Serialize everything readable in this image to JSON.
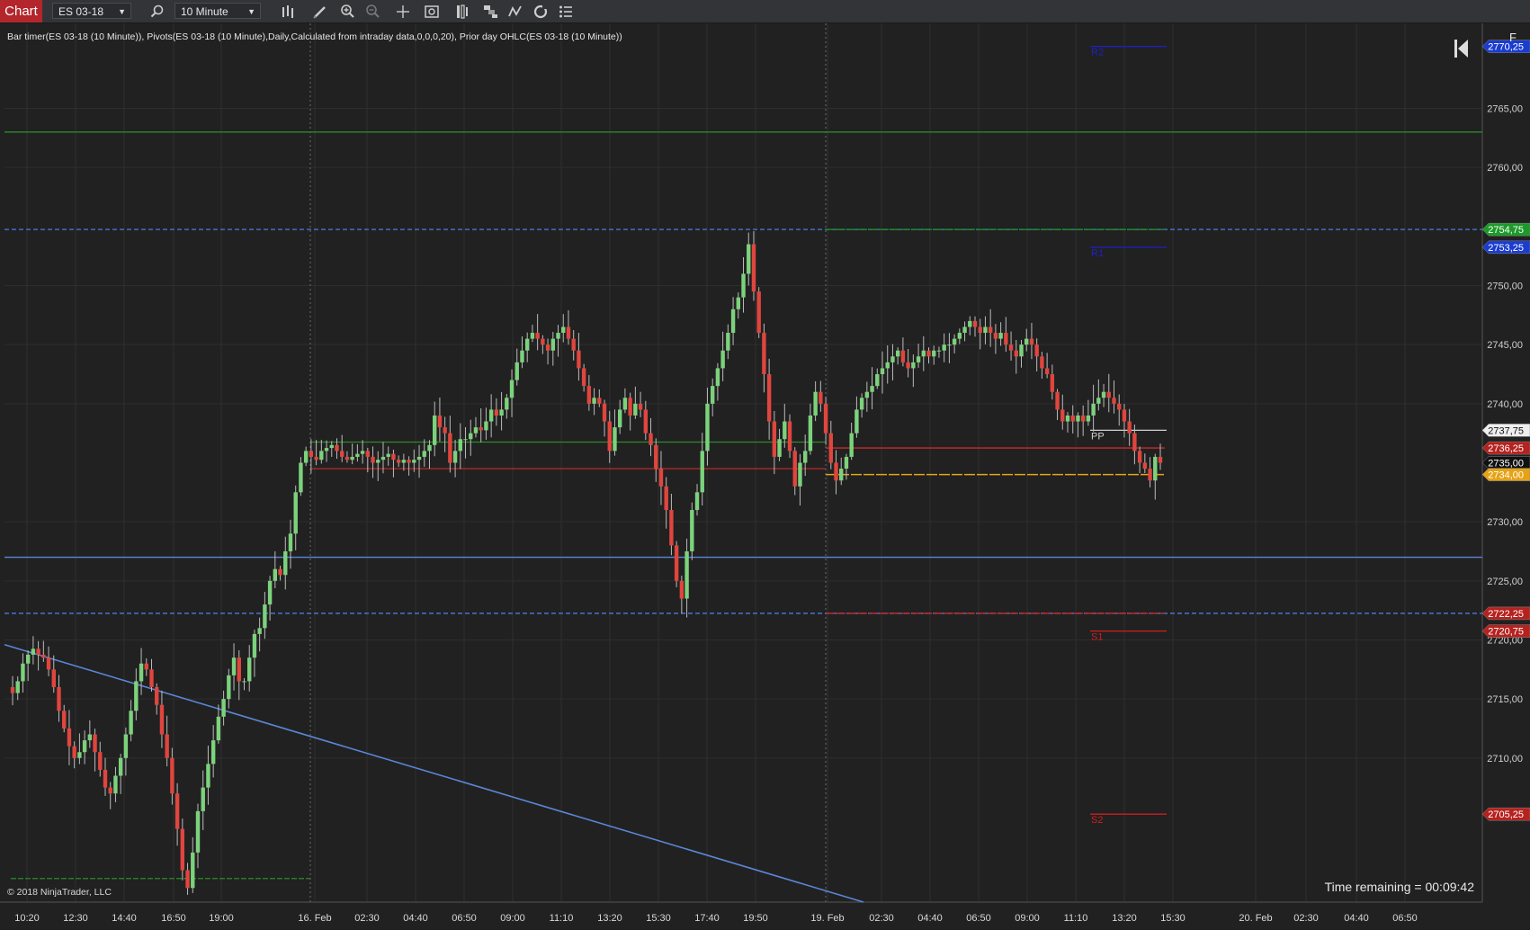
{
  "toolbar": {
    "chart_label": "Chart",
    "instrument": "ES 03-18",
    "interval": "10 Minute"
  },
  "indicators_label": "Bar timer(ES 03-18 (10 Minute)), Pivots(ES 03-18 (10 Minute),Daily,Calculated from intraday data,0,0,0,20), Prior day OHLC(ES 03-18 (10 Minute))",
  "copyright": "© 2018 NinjaTrader, LLC",
  "time_remaining": "Time remaining = 00:09:42",
  "f_button": "F",
  "colors": {
    "background": "#212121",
    "grid": "#333333",
    "up_candle": "#7cd27c",
    "down_candle": "#e0453e",
    "trendline": "#5a86d6",
    "resistance": "#2c8a2c",
    "pivot_r": "#2020c8",
    "pivot_s": "#cc2020",
    "pivot_pp": "#c8c8c8",
    "prior_close": "#e6a317"
  },
  "chart_data": {
    "type": "candlestick",
    "instrument": "ES 03-18",
    "interval": "10 Minute",
    "x_tick_labels": [
      "10:20",
      "12:30",
      "14:40",
      "16:50",
      "19:00",
      "16. Feb",
      "02:30",
      "04:40",
      "06:50",
      "09:00",
      "11:10",
      "13:20",
      "15:30",
      "17:40",
      "19:50",
      "19. Feb",
      "02:30",
      "04:40",
      "06:50",
      "09:00",
      "11:10",
      "13:20",
      "15:30",
      "20. Feb",
      "02:30",
      "04:40",
      "06:50"
    ],
    "y_tick_labels": [
      "2765,00",
      "2760,00",
      "2750,00",
      "2745,00",
      "2740,00",
      "2730,00",
      "2725,00",
      "2720,00",
      "2715,00",
      "2710,00"
    ],
    "y_tick_values": [
      2765,
      2760,
      2750,
      2745,
      2740,
      2730,
      2725,
      2720,
      2715,
      2710
    ],
    "ylim": [
      2697.8,
      2772.2
    ],
    "price_markers": [
      {
        "label": "2770,25",
        "value": 2770.25,
        "color": "#1a3ccf"
      },
      {
        "label": "2754,75",
        "value": 2754.75,
        "color": "#1d9a2a"
      },
      {
        "label": "2753,25",
        "value": 2753.25,
        "color": "#1a3ccf"
      },
      {
        "label": "2737,75",
        "value": 2737.75,
        "color": "#eeeeee"
      },
      {
        "label": "2736,25",
        "value": 2736.25,
        "color": "#b5221f"
      },
      {
        "label": "2735,00",
        "value": 2735.0,
        "color": "#111111"
      },
      {
        "label": "2734,00",
        "value": 2734.0,
        "color": "#e6a317"
      },
      {
        "label": "2722,25",
        "value": 2722.25,
        "color": "#b5221f"
      },
      {
        "label": "2720,75",
        "value": 2720.75,
        "color": "#b5221f"
      },
      {
        "label": "2705,25",
        "value": 2705.25,
        "color": "#b5221f"
      }
    ],
    "pivot_labels": [
      {
        "label": "R2",
        "value": 2770.25,
        "color": "#2020c8"
      },
      {
        "label": "R1",
        "value": 2753.25,
        "color": "#2020c8"
      },
      {
        "label": "PP",
        "value": 2737.75,
        "color": "#d0d0d0"
      },
      {
        "label": "S1",
        "value": 2720.75,
        "color": "#cc2020"
      },
      {
        "label": "S2",
        "value": 2705.25,
        "color": "#cc2020"
      }
    ],
    "horizontal_lines": [
      {
        "name": "resistance-line",
        "value": 2763.0,
        "color": "#2c8a2c",
        "style": "solid"
      },
      {
        "name": "prior-high-line",
        "value": 2754.75,
        "color": "#4a7be0",
        "style": "dashed"
      },
      {
        "name": "support-line",
        "value": 2727.0,
        "color": "#5a86d6",
        "style": "solid"
      },
      {
        "name": "prior-low-line",
        "value": 2722.25,
        "color": "#4a7be0",
        "style": "dashed"
      }
    ],
    "series": [
      {
        "name": "ES 03-18 close",
        "close": [
          2715.5,
          2716.5,
          2718.0,
          2718.75,
          2719.25,
          2718.75,
          2718.5,
          2717.5,
          2716.0,
          2714.0,
          2712.5,
          2711.0,
          2710.0,
          2710.5,
          2711.5,
          2712.0,
          2710.5,
          2709.0,
          2707.5,
          2707.0,
          2708.5,
          2710.0,
          2712.0,
          2714.0,
          2716.5,
          2718.0,
          2717.5,
          2716.0,
          2714.5,
          2712.0,
          2710.0,
          2707.0,
          2704.0,
          2700.5,
          2699.0,
          2702.0,
          2705.5,
          2707.5,
          2709.5,
          2711.5,
          2713.5,
          2715.0,
          2717.0,
          2718.5,
          2716.5,
          2716.5,
          2718.5,
          2720.5,
          2721.0,
          2723.0,
          2725.0,
          2726.0,
          2725.5,
          2727.5,
          2729.0,
          2732.5,
          2735.0,
          2736.0,
          2735.5,
          2735.25,
          2736.0,
          2736.25,
          2736.5,
          2736.0,
          2735.5,
          2735.25,
          2735.5,
          2735.75,
          2736.0,
          2735.5,
          2735.0,
          2735.25,
          2735.5,
          2735.75,
          2735.25,
          2735.0,
          2735.25,
          2735.0,
          2735.25,
          2735.5,
          2736.0,
          2736.5,
          2739.0,
          2738.0,
          2737.5,
          2735.0,
          2736.0,
          2737.0,
          2737.0,
          2737.5,
          2738.0,
          2737.75,
          2738.5,
          2739.5,
          2739.0,
          2739.5,
          2740.5,
          2742.0,
          2743.5,
          2744.5,
          2745.5,
          2746.0,
          2745.5,
          2745.0,
          2744.5,
          2745.5,
          2746.0,
          2746.5,
          2745.5,
          2744.5,
          2743.0,
          2741.5,
          2740.0,
          2740.5,
          2740.0,
          2738.5,
          2736.0,
          2738.0,
          2739.5,
          2740.5,
          2739.0,
          2740.0,
          2739.5,
          2737.5,
          2736.5,
          2734.5,
          2733.0,
          2731.0,
          2728.0,
          2725.0,
          2723.5,
          2727.5,
          2731.0,
          2732.5,
          2736.0,
          2740.0,
          2741.5,
          2743.0,
          2744.5,
          2746.0,
          2748.0,
          2749.0,
          2751.0,
          2753.5,
          2749.5,
          2746.0,
          2742.5,
          2738.5,
          2735.5,
          2737.0,
          2738.5,
          2736.0,
          2733.0,
          2735.0,
          2736.0,
          2739.0,
          2741.0,
          2740.0,
          2737.5,
          2735.0,
          2733.5,
          2734.5,
          2735.5,
          2737.5,
          2739.5,
          2740.5,
          2741.0,
          2741.5,
          2742.5,
          2743.0,
          2743.5,
          2744.0,
          2744.5,
          2743.5,
          2743.0,
          2743.5,
          2744.0,
          2744.5,
          2744.0,
          2744.5,
          2744.5,
          2745.0,
          2745.0,
          2745.5,
          2746.0,
          2746.5,
          2747.0,
          2746.5,
          2746.0,
          2746.5,
          2746.0,
          2745.5,
          2746.0,
          2745.0,
          2744.5,
          2744.0,
          2745.0,
          2745.5,
          2745.0,
          2744.0,
          2743.0,
          2742.5,
          2741.0,
          2739.5,
          2738.5,
          2739.0,
          2738.5,
          2739.0,
          2738.5,
          2739.0,
          2740.0,
          2740.5,
          2741.0,
          2740.5,
          2740.0,
          2739.5,
          2738.5,
          2737.5,
          2736.0,
          2735.0,
          2734.5,
          2733.5,
          2735.5,
          2735.0
        ]
      }
    ]
  }
}
